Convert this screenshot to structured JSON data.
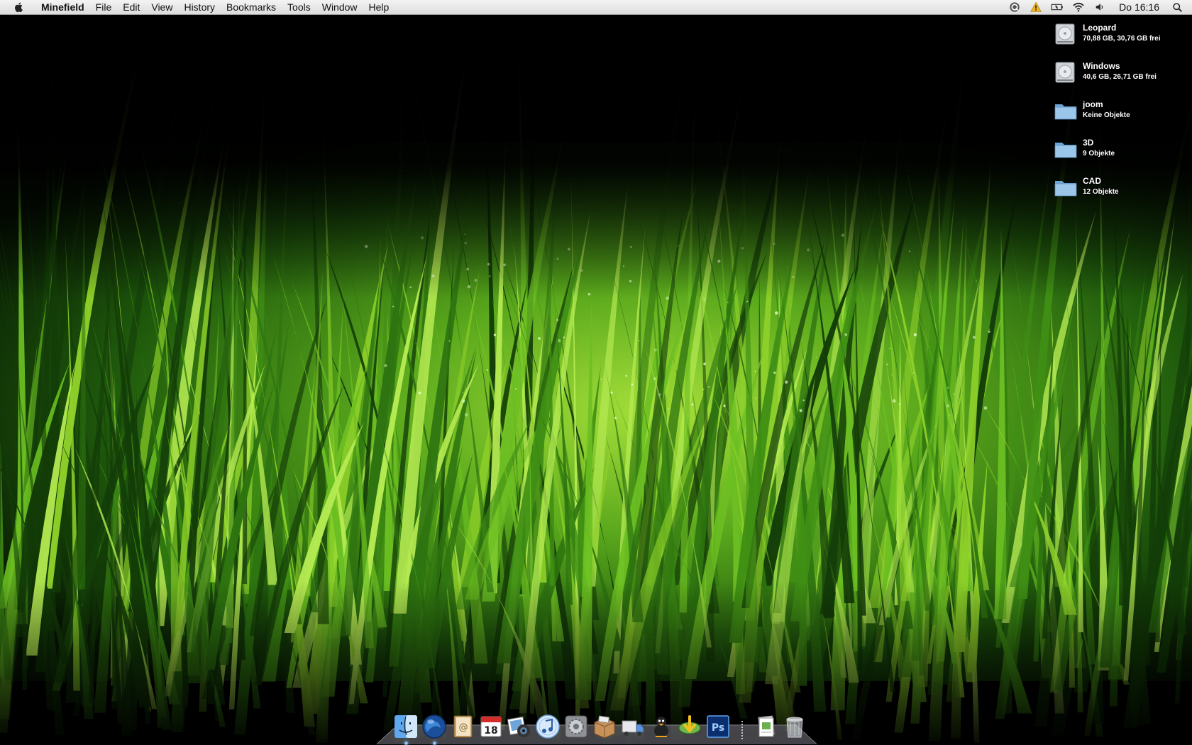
{
  "menubar": {
    "app_name": "Minefield",
    "menus": [
      "File",
      "Edit",
      "View",
      "History",
      "Bookmarks",
      "Tools",
      "Window",
      "Help"
    ],
    "status_icons": [
      "quicksilver-icon",
      "warning-icon",
      "battery-icon",
      "wifi-icon",
      "volume-icon"
    ],
    "clock": "Do 16:16"
  },
  "desktop": {
    "items": [
      {
        "name": "Leopard",
        "info": "70,88 GB, 30,76 GB frei",
        "kind": "disk"
      },
      {
        "name": "Windows",
        "info": "40,6 GB, 26,71 GB frei",
        "kind": "disk"
      },
      {
        "name": "joom",
        "info": "Keine Objekte",
        "kind": "folder"
      },
      {
        "name": "3D",
        "info": "9 Objekte",
        "kind": "folder"
      },
      {
        "name": "CAD",
        "info": "12 Objekte",
        "kind": "folder"
      }
    ]
  },
  "dock": {
    "apps": [
      {
        "icon": "finder-icon",
        "running": true
      },
      {
        "icon": "firefox-minefield-icon",
        "running": true
      },
      {
        "icon": "address-book-icon",
        "running": false
      },
      {
        "icon": "ical-icon",
        "label": "18",
        "running": false
      },
      {
        "icon": "iphoto-icon",
        "running": false
      },
      {
        "icon": "itunes-icon",
        "running": false
      },
      {
        "icon": "system-preferences-icon",
        "running": false
      },
      {
        "icon": "package-icon",
        "running": false
      },
      {
        "icon": "transmit-truck-icon",
        "running": false
      },
      {
        "icon": "adium-duck-icon",
        "running": false
      },
      {
        "icon": "cyberduck-download-icon",
        "running": false
      },
      {
        "icon": "photoshop-icon",
        "label": "Ps",
        "running": false
      }
    ],
    "docs": [
      {
        "icon": "document-stack-icon"
      },
      {
        "icon": "trash-icon"
      }
    ]
  },
  "colors": {
    "grass_light": "#8fd12a",
    "grass_mid": "#3f8f14",
    "grass_dark": "#133d08",
    "menubar_bg": "#e6e6e6"
  }
}
